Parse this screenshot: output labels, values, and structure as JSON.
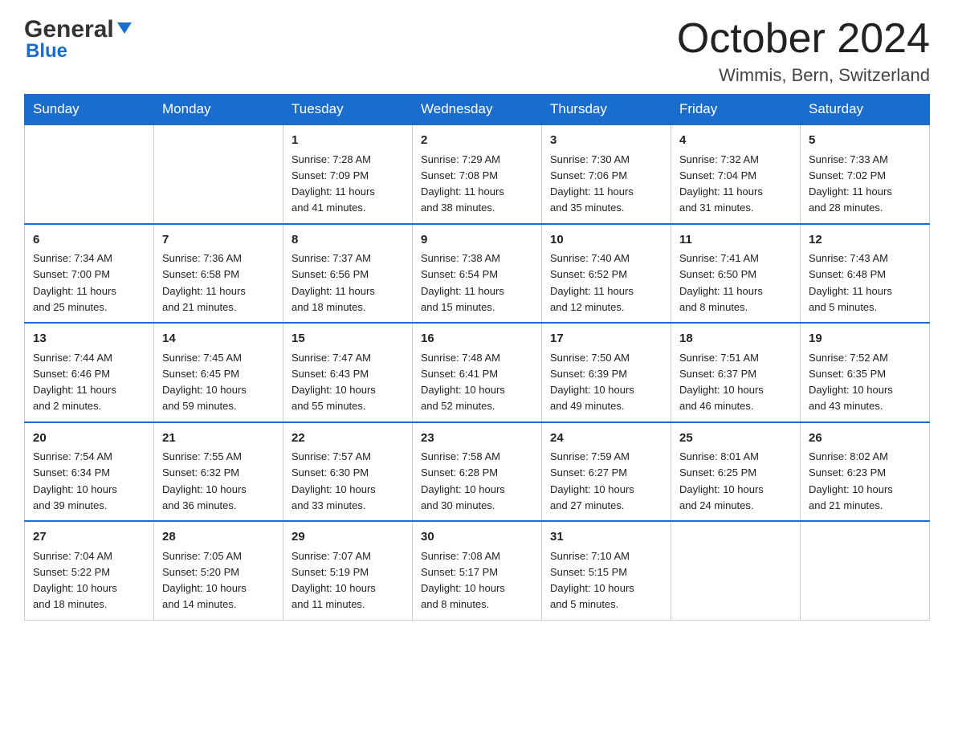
{
  "header": {
    "logo_general": "General",
    "logo_blue": "Blue",
    "month_title": "October 2024",
    "location": "Wimmis, Bern, Switzerland"
  },
  "days_of_week": [
    "Sunday",
    "Monday",
    "Tuesday",
    "Wednesday",
    "Thursday",
    "Friday",
    "Saturday"
  ],
  "weeks": [
    [
      {
        "day": "",
        "info": ""
      },
      {
        "day": "",
        "info": ""
      },
      {
        "day": "1",
        "info": "Sunrise: 7:28 AM\nSunset: 7:09 PM\nDaylight: 11 hours\nand 41 minutes."
      },
      {
        "day": "2",
        "info": "Sunrise: 7:29 AM\nSunset: 7:08 PM\nDaylight: 11 hours\nand 38 minutes."
      },
      {
        "day": "3",
        "info": "Sunrise: 7:30 AM\nSunset: 7:06 PM\nDaylight: 11 hours\nand 35 minutes."
      },
      {
        "day": "4",
        "info": "Sunrise: 7:32 AM\nSunset: 7:04 PM\nDaylight: 11 hours\nand 31 minutes."
      },
      {
        "day": "5",
        "info": "Sunrise: 7:33 AM\nSunset: 7:02 PM\nDaylight: 11 hours\nand 28 minutes."
      }
    ],
    [
      {
        "day": "6",
        "info": "Sunrise: 7:34 AM\nSunset: 7:00 PM\nDaylight: 11 hours\nand 25 minutes."
      },
      {
        "day": "7",
        "info": "Sunrise: 7:36 AM\nSunset: 6:58 PM\nDaylight: 11 hours\nand 21 minutes."
      },
      {
        "day": "8",
        "info": "Sunrise: 7:37 AM\nSunset: 6:56 PM\nDaylight: 11 hours\nand 18 minutes."
      },
      {
        "day": "9",
        "info": "Sunrise: 7:38 AM\nSunset: 6:54 PM\nDaylight: 11 hours\nand 15 minutes."
      },
      {
        "day": "10",
        "info": "Sunrise: 7:40 AM\nSunset: 6:52 PM\nDaylight: 11 hours\nand 12 minutes."
      },
      {
        "day": "11",
        "info": "Sunrise: 7:41 AM\nSunset: 6:50 PM\nDaylight: 11 hours\nand 8 minutes."
      },
      {
        "day": "12",
        "info": "Sunrise: 7:43 AM\nSunset: 6:48 PM\nDaylight: 11 hours\nand 5 minutes."
      }
    ],
    [
      {
        "day": "13",
        "info": "Sunrise: 7:44 AM\nSunset: 6:46 PM\nDaylight: 11 hours\nand 2 minutes."
      },
      {
        "day": "14",
        "info": "Sunrise: 7:45 AM\nSunset: 6:45 PM\nDaylight: 10 hours\nand 59 minutes."
      },
      {
        "day": "15",
        "info": "Sunrise: 7:47 AM\nSunset: 6:43 PM\nDaylight: 10 hours\nand 55 minutes."
      },
      {
        "day": "16",
        "info": "Sunrise: 7:48 AM\nSunset: 6:41 PM\nDaylight: 10 hours\nand 52 minutes."
      },
      {
        "day": "17",
        "info": "Sunrise: 7:50 AM\nSunset: 6:39 PM\nDaylight: 10 hours\nand 49 minutes."
      },
      {
        "day": "18",
        "info": "Sunrise: 7:51 AM\nSunset: 6:37 PM\nDaylight: 10 hours\nand 46 minutes."
      },
      {
        "day": "19",
        "info": "Sunrise: 7:52 AM\nSunset: 6:35 PM\nDaylight: 10 hours\nand 43 minutes."
      }
    ],
    [
      {
        "day": "20",
        "info": "Sunrise: 7:54 AM\nSunset: 6:34 PM\nDaylight: 10 hours\nand 39 minutes."
      },
      {
        "day": "21",
        "info": "Sunrise: 7:55 AM\nSunset: 6:32 PM\nDaylight: 10 hours\nand 36 minutes."
      },
      {
        "day": "22",
        "info": "Sunrise: 7:57 AM\nSunset: 6:30 PM\nDaylight: 10 hours\nand 33 minutes."
      },
      {
        "day": "23",
        "info": "Sunrise: 7:58 AM\nSunset: 6:28 PM\nDaylight: 10 hours\nand 30 minutes."
      },
      {
        "day": "24",
        "info": "Sunrise: 7:59 AM\nSunset: 6:27 PM\nDaylight: 10 hours\nand 27 minutes."
      },
      {
        "day": "25",
        "info": "Sunrise: 8:01 AM\nSunset: 6:25 PM\nDaylight: 10 hours\nand 24 minutes."
      },
      {
        "day": "26",
        "info": "Sunrise: 8:02 AM\nSunset: 6:23 PM\nDaylight: 10 hours\nand 21 minutes."
      }
    ],
    [
      {
        "day": "27",
        "info": "Sunrise: 7:04 AM\nSunset: 5:22 PM\nDaylight: 10 hours\nand 18 minutes."
      },
      {
        "day": "28",
        "info": "Sunrise: 7:05 AM\nSunset: 5:20 PM\nDaylight: 10 hours\nand 14 minutes."
      },
      {
        "day": "29",
        "info": "Sunrise: 7:07 AM\nSunset: 5:19 PM\nDaylight: 10 hours\nand 11 minutes."
      },
      {
        "day": "30",
        "info": "Sunrise: 7:08 AM\nSunset: 5:17 PM\nDaylight: 10 hours\nand 8 minutes."
      },
      {
        "day": "31",
        "info": "Sunrise: 7:10 AM\nSunset: 5:15 PM\nDaylight: 10 hours\nand 5 minutes."
      },
      {
        "day": "",
        "info": ""
      },
      {
        "day": "",
        "info": ""
      }
    ]
  ]
}
